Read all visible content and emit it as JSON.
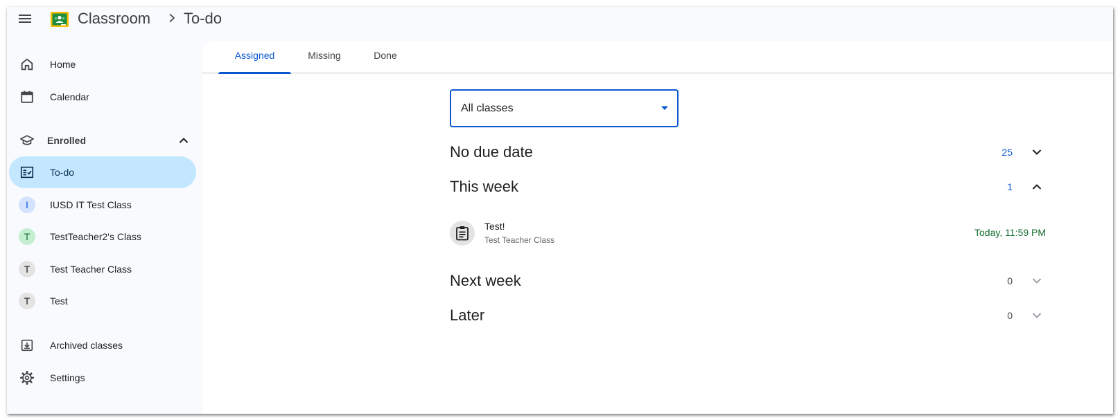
{
  "header": {
    "app_name": "Classroom",
    "page_name": "To-do",
    "icons": {
      "menu": "hamburger-menu-icon",
      "logo": "classroom-logo-icon",
      "separator": "chevron-right-icon"
    }
  },
  "sidebar": {
    "top_items": [
      {
        "label": "Home",
        "icon": "home-icon"
      },
      {
        "label": "Calendar",
        "icon": "calendar-icon"
      }
    ],
    "enrolled": {
      "label": "Enrolled",
      "icon": "graduation-cap-icon",
      "expanded": true,
      "todo": {
        "label": "To-do",
        "icon": "todo-checklist-icon",
        "active": true
      },
      "classes": [
        {
          "initial": "I",
          "label": "IUSD IT Test Class",
          "avatar_bg": "#d3e3fd",
          "avatar_fg": "#0b57d0"
        },
        {
          "initial": "T",
          "label": "TestTeacher2's Class",
          "avatar_bg": "#c4eed0",
          "avatar_fg": "#146c2e"
        },
        {
          "initial": "T",
          "label": "Test Teacher Class",
          "avatar_bg": "#e3e3e3",
          "avatar_fg": "#1f1f1f"
        },
        {
          "initial": "T",
          "label": "Test",
          "avatar_bg": "#e3e3e3",
          "avatar_fg": "#1f1f1f"
        }
      ]
    },
    "bottom_items": [
      {
        "label": "Archived classes",
        "icon": "archive-icon"
      },
      {
        "label": "Settings",
        "icon": "gear-icon"
      }
    ]
  },
  "tabs": [
    {
      "label": "Assigned",
      "active": true
    },
    {
      "label": "Missing",
      "active": false
    },
    {
      "label": "Done",
      "active": false
    }
  ],
  "filter": {
    "value": "All classes",
    "icon": "dropdown-caret-icon"
  },
  "groups": [
    {
      "title": "No due date",
      "count": "25",
      "expanded": false
    },
    {
      "title": "This week",
      "count": "1",
      "expanded": true
    },
    {
      "title": "Next week",
      "count": "0",
      "expanded": false
    },
    {
      "title": "Later",
      "count": "0",
      "expanded": false
    }
  ],
  "task": {
    "title": "Test!",
    "class_name": "Test Teacher Class",
    "due": "Today, 11:59 PM",
    "icon": "assignment-icon"
  },
  "colors": {
    "accent": "#0b57d0",
    "active_nav_bg": "#c2e7ff",
    "due_text": "#146c2e",
    "count_active": "#0b57d0",
    "count_empty": "#444746"
  }
}
